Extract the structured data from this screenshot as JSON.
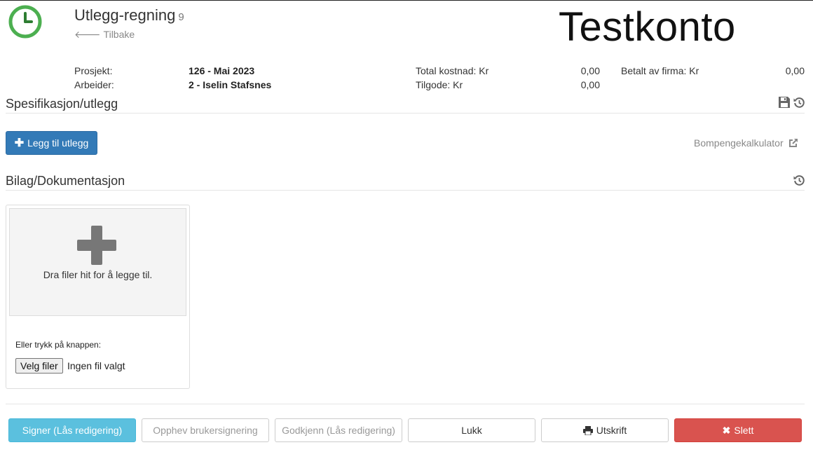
{
  "header": {
    "title": "Utlegg-regning",
    "count": "9",
    "back_label": "Tilbake",
    "watermark": "Testkonto"
  },
  "info": {
    "project_label": "Prosjekt:",
    "project_value": "126 - Mai 2023",
    "worker_label": "Arbeider:",
    "worker_value": "2 - Iselin Stafsnes",
    "total_cost_label": "Total kostnad: Kr",
    "total_cost_value": "0,00",
    "credit_label": "Tilgode: Kr",
    "credit_value": "0,00",
    "paid_by_company_label": "Betalt av firma: Kr",
    "paid_by_company_value": "0,00"
  },
  "spec": {
    "title": "Spesifikasjon/utlegg",
    "add_label": "Legg til utlegg",
    "calculator_label": "Bompengekalkulator"
  },
  "attachments": {
    "title": "Bilag/Dokumentasjon",
    "drop_text": "Dra filer hit for å legge til.",
    "or_text": "Eller trykk på knappen:",
    "choose_files": "Velg filer",
    "no_file": "Ingen fil valgt"
  },
  "footer": {
    "sign_label": "Signer (Lås redigering)",
    "revoke_label": "Opphev brukersignering",
    "approve_label": "Godkjenn (Lås redigering)",
    "close_label": "Lukk",
    "print_label": "Utskrift",
    "delete_label": "Slett"
  },
  "colors": {
    "primary": "#337ab7",
    "info": "#5bc0de",
    "danger": "#d9534f",
    "logo_green": "#4caf50"
  },
  "icons": [
    "clock-icon",
    "arrow-left-icon",
    "save-icon",
    "history-icon",
    "plus-icon",
    "external-link-icon",
    "print-icon",
    "times-icon"
  ]
}
